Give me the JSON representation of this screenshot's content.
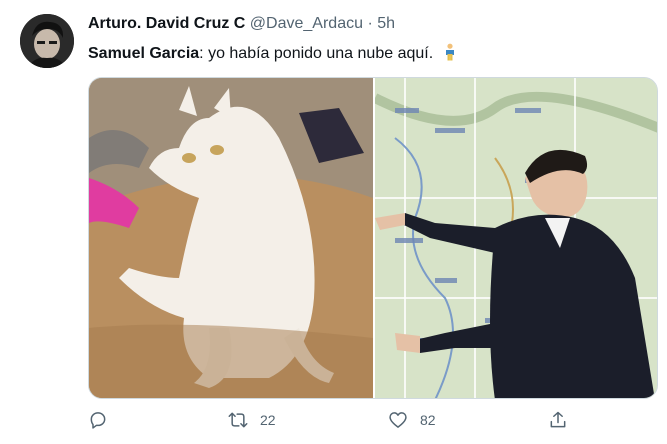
{
  "tweet": {
    "display_name": "Arturo. David Cruz C",
    "handle": "@Dave_Ardacu",
    "separator": "·",
    "time": "5h",
    "text_speaker": "Samuel Garcia",
    "text_body": ": yo había ponido una nube aquí.",
    "emoji_icon": "man-standing-icon"
  },
  "actions": {
    "reply_icon": "reply-icon",
    "retweet_icon": "retweet-icon",
    "retweet_count": "22",
    "like_icon": "heart-icon",
    "like_count": "82",
    "share_icon": "share-icon"
  },
  "colors": {
    "text": "#0f1419",
    "secondary": "#536471",
    "border": "#cfd9de"
  }
}
